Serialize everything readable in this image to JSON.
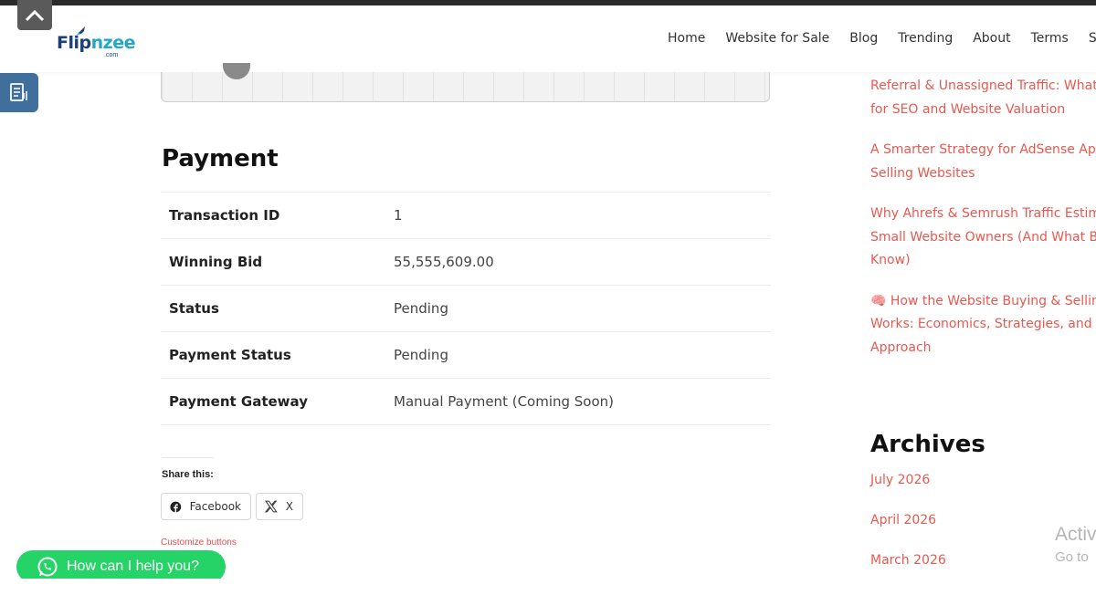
{
  "header": {
    "logo_text_a": "Flip",
    "logo_text_b": "nzee",
    "logo_domain": ".com",
    "nav": [
      "Home",
      "Website for Sale",
      "Blog",
      "Trending",
      "About",
      "Terms",
      "Sup"
    ]
  },
  "payment": {
    "title": "Payment",
    "rows": [
      {
        "label": "Transaction ID",
        "value": "1"
      },
      {
        "label": "Winning Bid",
        "value": "55,555,609.00"
      },
      {
        "label": "Status",
        "value": "Pending"
      },
      {
        "label": "Payment Status",
        "value": "Pending"
      },
      {
        "label": "Payment Gateway",
        "value": "Manual Payment (Coming Soon)"
      }
    ]
  },
  "share": {
    "title": "Share this:",
    "facebook_label": "Facebook",
    "x_label": "X",
    "customize_label": "Customize buttons"
  },
  "whatsapp": {
    "label": "How can I help you?"
  },
  "sidebar": {
    "posts": [
      {
        "lines": [
          "Referral & Unassigned Traffic: What",
          "for SEO and Website Valuation"
        ]
      },
      {
        "lines": [
          "A Smarter Strategy for AdSense App",
          "Selling Websites"
        ]
      },
      {
        "lines": [
          "Why Ahrefs & Semrush Traffic Estima",
          "Small Website Owners (And What B",
          "Know)"
        ]
      },
      {
        "lines": [
          "🧠 How the Website Buying & Selling",
          "Works: Economics, Strategies, and th",
          "Approach"
        ]
      }
    ],
    "archives_title": "Archives",
    "archives": [
      "July 2026",
      "April 2026",
      "March 2026"
    ]
  },
  "watermark": {
    "line1": "Activ",
    "line2": "Go to"
  },
  "colors": {
    "accent_link": "#e8584f",
    "whatsapp": "#25d366",
    "logo_dark": "#1c3f78",
    "logo_light": "#22a7c9"
  }
}
